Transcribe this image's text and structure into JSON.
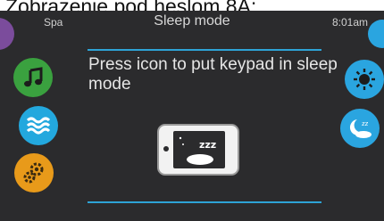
{
  "caption": {
    "text": "Zobrazenie pod heslom 8A:"
  },
  "status_bar": {
    "left_label": "Spa",
    "title": "Sleep mode",
    "time": "8:01am"
  },
  "message": {
    "text": "Press icon to put keypad in sleep mode"
  },
  "colors": {
    "screen_background": "#2b2b2d",
    "accent_line": "#2ea3d6",
    "music_button": "#3aa13f",
    "waves_button": "#23a8de",
    "settings_button": "#e89a1a",
    "purple_button": "#7b4c9c",
    "right_buttons": "#2aa5e0"
  },
  "icons": {
    "left": [
      "purple-circle-icon",
      "music-note-icon",
      "water-waves-icon",
      "gears-icon"
    ],
    "right": [
      "partial-blue-icon",
      "brightness-icon",
      "sleep-moon-icon"
    ],
    "center": "keypad-sleep-icon"
  }
}
